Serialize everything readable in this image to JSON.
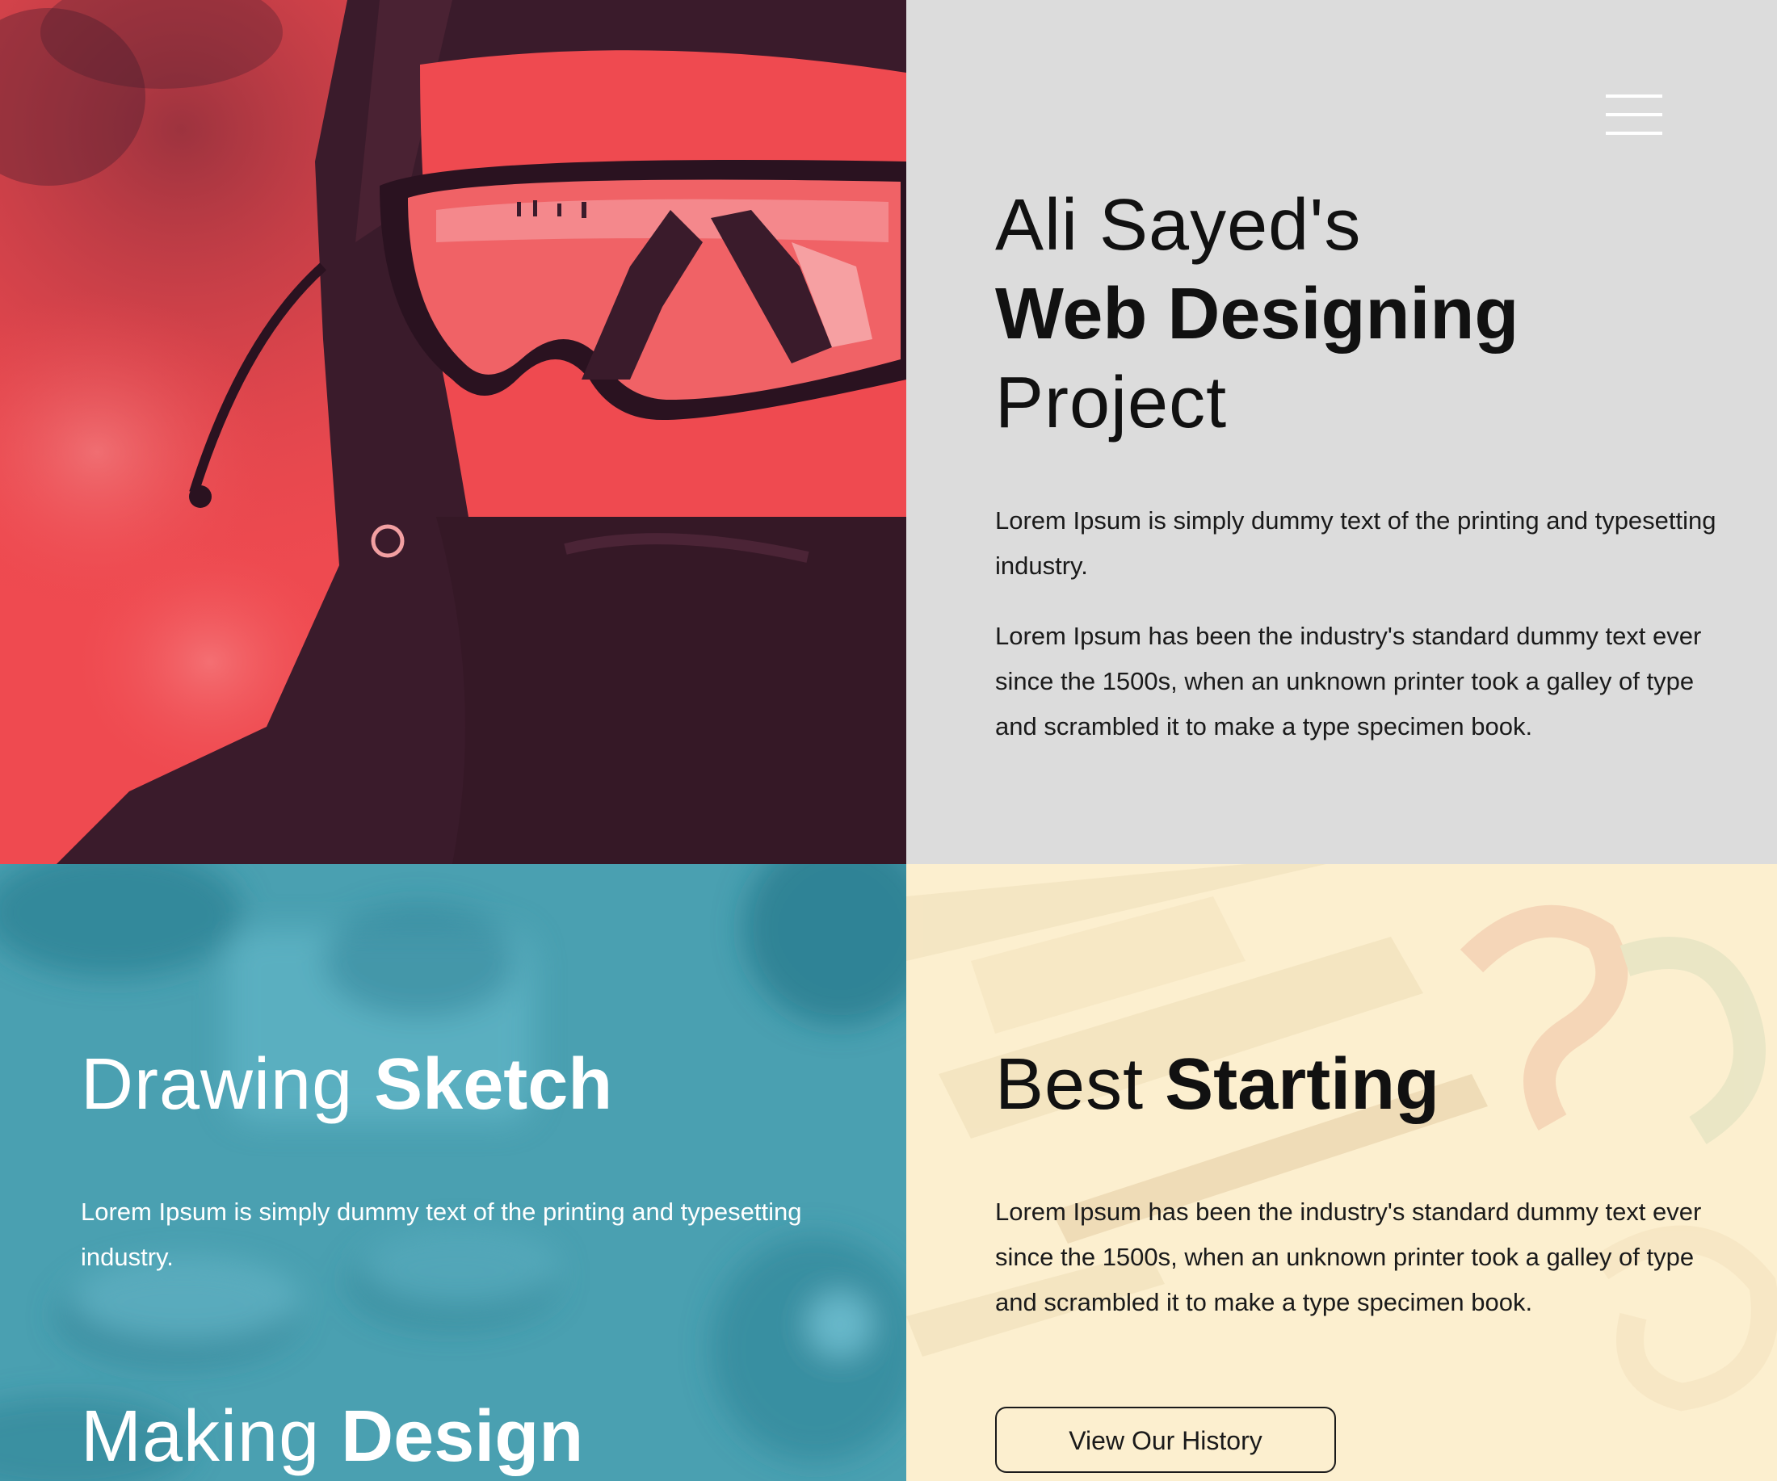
{
  "menu": {
    "icon": "hamburger-menu-icon",
    "color": "#ffffff"
  },
  "hero_image": {
    "subject": "skier wearing goggles and balaclava",
    "tint": "#f04a4f"
  },
  "intro": {
    "heading_line1": "Ali Sayed's",
    "heading_line2": "Web Designing",
    "heading_line3": "Project",
    "paragraph1": "Lorem Ipsum is simply dummy text of the printing and typesetting industry.",
    "paragraph2": "Lorem Ipsum has been the industry's standard dummy text ever since the 1500s, when an unknown printer took a galley of type and scrambled it to make a type specimen book."
  },
  "sketch": {
    "heading_light": "Drawing",
    "heading_bold": "Sketch",
    "paragraph": "Lorem Ipsum is simply dummy text of the printing and typesetting industry.",
    "tint": "#4aa0b1"
  },
  "making": {
    "heading_light": "Making",
    "heading_bold": "Design"
  },
  "start": {
    "heading_light": "Best",
    "heading_bold": "Starting",
    "paragraph": "Lorem Ipsum has been the industry's standard dummy text ever since the 1500s, when an unknown printer took a galley of type and scrambled it to make a type specimen book.",
    "button_label": "View Our History",
    "tint": "#fcefcf"
  },
  "colors": {
    "intro_background": "#dcdcdc",
    "text_dark": "#111111",
    "text_light": "#ffffff"
  }
}
